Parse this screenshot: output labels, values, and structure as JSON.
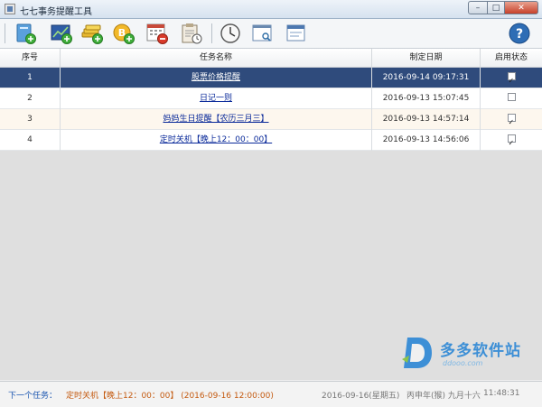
{
  "window": {
    "title": "七七事务提醒工具",
    "controls": {
      "minimize": "–",
      "maximize": "□",
      "close": "✕"
    }
  },
  "toolbar": {
    "buttons": [
      {
        "name": "new-task-icon"
      },
      {
        "name": "stock-alert-icon"
      },
      {
        "name": "money-icon"
      },
      {
        "name": "bitcoin-icon"
      },
      {
        "name": "calendar-delete-icon"
      },
      {
        "name": "clipboard-schedule-icon"
      },
      {
        "name": "clock-icon"
      },
      {
        "name": "browser-search-icon"
      },
      {
        "name": "window-icon"
      },
      {
        "name": "help-icon"
      }
    ]
  },
  "table": {
    "columns": [
      "序号",
      "任务名称",
      "制定日期",
      "启用状态"
    ],
    "rows": [
      {
        "seq": "1",
        "name": "股票价格提醒",
        "date": "2016-09-14 09:17:31",
        "enabled": true,
        "selected": true
      },
      {
        "seq": "2",
        "name": "日记一则",
        "date": "2016-09-13 15:07:45",
        "enabled": false,
        "selected": false
      },
      {
        "seq": "3",
        "name": "妈妈生日提醒【农历三月三】",
        "date": "2016-09-13 14:57:14",
        "enabled": true,
        "selected": false
      },
      {
        "seq": "4",
        "name": "定时关机【晚上12：00：00】",
        "date": "2016-09-13 14:56:06",
        "enabled": true,
        "selected": false
      }
    ]
  },
  "watermark": {
    "name": "多多软件站",
    "domain": "ddooo.com"
  },
  "status": {
    "next_label": "下一个任务：",
    "next_task": "定时关机【晚上12：00：00】 (2016-09-16 12:00:00)",
    "date": "2016-09-16(星期五)",
    "lunar": "丙申年(猴) 九月十六",
    "time": "11:48:31"
  },
  "colors": {
    "selected_row": "#2f4b7c",
    "link": "#0a2a9a",
    "status_task": "#c45a10",
    "status_label": "#1a55b0"
  }
}
